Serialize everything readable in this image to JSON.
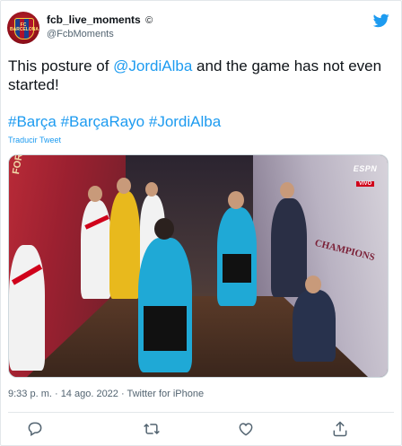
{
  "account": {
    "display_name": "fcb_live_moments",
    "badge": "©",
    "handle": "@FcbMoments",
    "avatar_label": "FC BARCELONA"
  },
  "tweet": {
    "text_before": "This posture of ",
    "mention": "@JordiAlba",
    "text_after": " and the game has not even started!",
    "hashtags": "#Barça #BarçaRayo #JordiAlba",
    "translate_label": "Traducir Tweet"
  },
  "media": {
    "broadcaster_logo": "ESPN",
    "live_label": "VIVO",
    "banner_right": "CHAMPIONS",
    "banner_left": "FORÇA"
  },
  "meta": {
    "timestamp": "9:33 p. m. · 14 ago. 2022 · Twitter for iPhone"
  },
  "actions": [
    {
      "icon": "reply-icon"
    },
    {
      "icon": "retweet-icon"
    },
    {
      "icon": "like-icon"
    },
    {
      "icon": "share-icon"
    }
  ],
  "colors": {
    "link": "#1d9bf0",
    "muted": "#536471",
    "border": "#e3e7ea"
  }
}
